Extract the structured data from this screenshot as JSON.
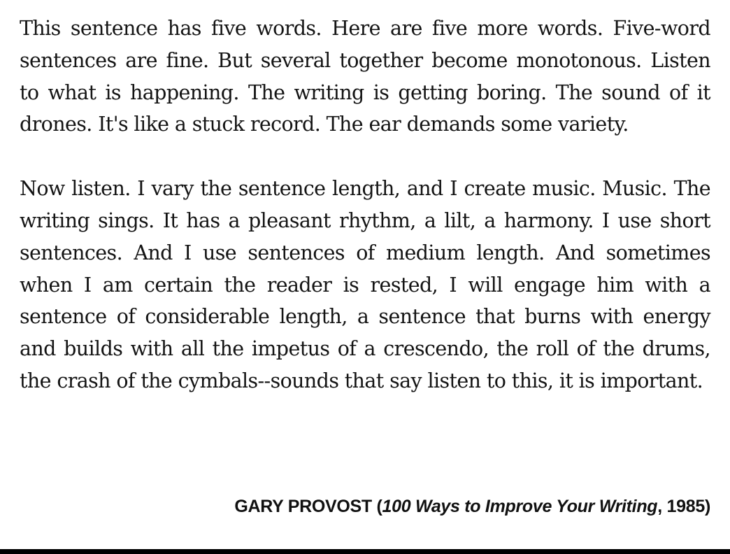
{
  "paragraphs": [
    "This sentence has five words. Here are five more words. Five-word sentences are fine. But several together become monotonous. Listen to what is happening. The writing is getting boring. The sound of it drones. It's like a stuck record. The ear demands some variety.",
    "Now listen. I vary the sentence length, and I create music. Music. The writing sings. It has a pleasant rhythm, a lilt, a harmony. I use short sentences. And I use sentences of medium length. And sometimes when I am certain the reader is rested, I will engage him with a sentence of considerable length, a sentence that burns with energy and builds with all the impetus of a crescendo, the roll of the drums, the crash of the cymbals--sounds that say listen to this, it is important."
  ],
  "attribution": {
    "author": "GARY PROVOST",
    "open": " (",
    "title": "100 Ways to Improve Your Writing",
    "year_suffix": ", 1985)"
  }
}
